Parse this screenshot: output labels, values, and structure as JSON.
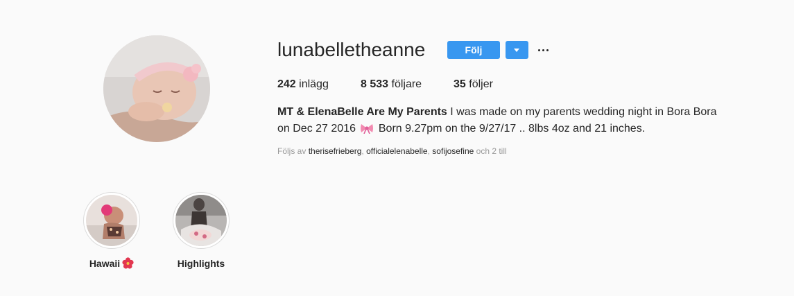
{
  "profile": {
    "username": "lunabelletheanne",
    "follow_label": "Följ",
    "dropdown_icon": "caret-down-icon",
    "more_icon": "ellipsis-icon"
  },
  "stats": {
    "posts_count": "242",
    "posts_label": " inlägg",
    "followers_count": "8 533",
    "followers_label": " följare",
    "following_count": "35",
    "following_label": " följer"
  },
  "bio": {
    "name": "MT & ElenaBelle Are My Parents",
    "text_part1": " I was made on my parents wedding night in Bora Bora on Dec 27 2016 ",
    "bow_icon": "pink-ribbon-emoji",
    "text_part2": " Born 9.27pm on the 9/27/17 .. 8lbs 4oz and 21 inches."
  },
  "followed_by": {
    "prefix": "Följs av ",
    "accounts": [
      "therisefrieberg",
      "officialelenabelle",
      "sofijosefine"
    ],
    "separator": ", ",
    "suffix": " och 2 till"
  },
  "highlights": [
    {
      "label": "Hawaii",
      "icon": "hibiscus-emoji"
    },
    {
      "label": "Highlights"
    }
  ],
  "colors": {
    "accent": "#3897f0",
    "background": "#fafafa",
    "text": "#262626",
    "muted": "#999999"
  }
}
